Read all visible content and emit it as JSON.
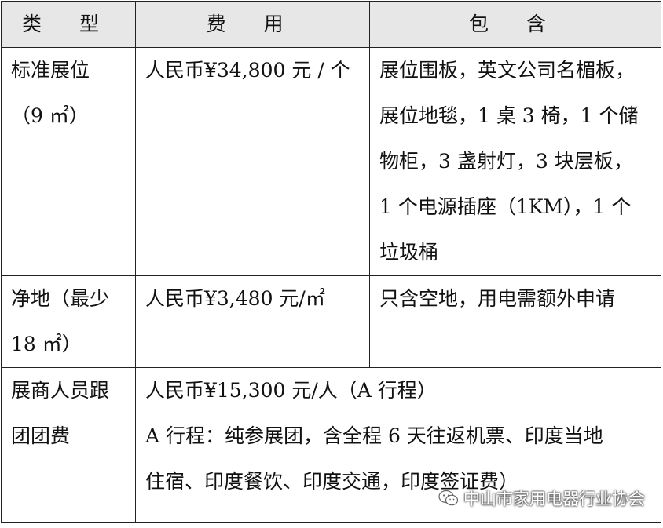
{
  "header": {
    "type": "类 型",
    "fee": "费 用",
    "includes": "包 含"
  },
  "rows": [
    {
      "type_lines": [
        "标准展位",
        "（9 ㎡）"
      ],
      "fee": "人民币¥34,800 元 / 个",
      "include_lines": [
        "展位围板，英文公司名楣板，",
        "展位地毯，1 桌 3 椅，1 个储",
        "物柜，3 盏射灯，3 块层板，",
        "1 个电源插座（1KM），1 个",
        "垃圾桶"
      ]
    },
    {
      "type_lines": [
        "净地（最少",
        "18 ㎡）"
      ],
      "fee": "人民币¥3,480 元/㎡",
      "include_lines": [
        "只含空地，用电需额外申请"
      ]
    },
    {
      "type_lines": [
        "展商人员跟",
        "团团费"
      ],
      "merged_lines": [
        "人民币¥15,300 元/人（A 行程）",
        "A 行程：纯参展团，含全程 6 天往返机票、印度当地",
        "住宿、印度餐饮、印度交通，印度签证费）"
      ]
    }
  ],
  "watermark": {
    "text": "中山市家用电器行业协会",
    "icon": "wechat-icon"
  }
}
